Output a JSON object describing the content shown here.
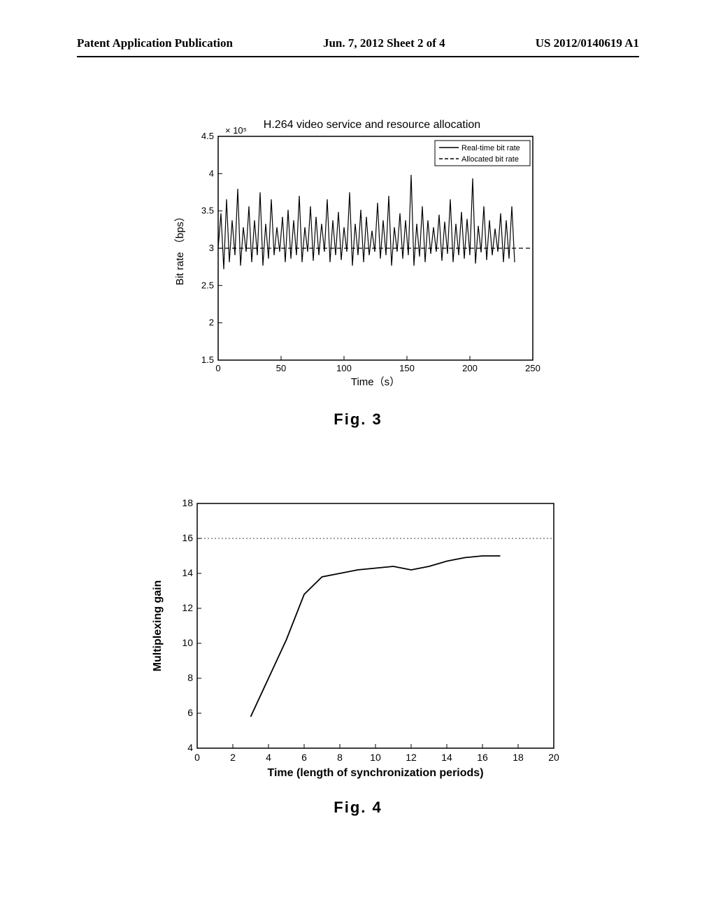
{
  "header": {
    "left": "Patent Application Publication",
    "center": "Jun. 7, 2012  Sheet 2 of 4",
    "right": "US 2012/0140619 A1"
  },
  "fig3": {
    "title": "H.264 video service and resource allocation",
    "exponent": "× 10⁵",
    "ylabel": "Bit rate （bps）",
    "xlabel": "Time（s）",
    "legend1": "Real-time bit rate",
    "legend2": "Allocated bit rate",
    "caption": "Fig. 3"
  },
  "fig4": {
    "ylabel": "Multiplexing gain",
    "xlabel": "Time (length of synchronization periods)",
    "caption": "Fig. 4"
  },
  "chart_data": [
    {
      "type": "line",
      "title": "H.264 video service and resource allocation",
      "xlabel": "Time (s)",
      "ylabel": "Bit rate (bps)",
      "xlim": [
        0,
        250
      ],
      "ylim": [
        150000.0,
        450000.0
      ],
      "xticks": [
        0,
        50,
        100,
        150,
        200,
        250
      ],
      "yticks": [
        1.5,
        2,
        2.5,
        3,
        3.5,
        4,
        4.5
      ],
      "y_exponent": 5,
      "series": [
        {
          "name": "Real-time bit rate",
          "style": "solid",
          "note": "Highly oscillating signal ~2.5e5–4.0e5 bps over 0–250s; dense spikes every ~3–5s"
        },
        {
          "name": "Allocated bit rate",
          "style": "dashed",
          "x": [
            0,
            250
          ],
          "y": [
            300000.0,
            300000.0
          ]
        }
      ]
    },
    {
      "type": "line",
      "title": "",
      "xlabel": "Time (length of synchronization periods)",
      "ylabel": "Multiplexing gain",
      "xlim": [
        0,
        20
      ],
      "ylim": [
        4,
        18
      ],
      "xticks": [
        0,
        2,
        4,
        6,
        8,
        10,
        12,
        14,
        16,
        18,
        20
      ],
      "yticks": [
        4,
        6,
        8,
        10,
        12,
        14,
        16,
        18
      ],
      "grid_y": [
        16
      ],
      "series": [
        {
          "name": "Multiplexing gain",
          "style": "solid",
          "x": [
            3,
            4,
            5,
            6,
            7,
            8,
            9,
            10,
            11,
            12,
            13,
            14,
            15,
            16,
            17
          ],
          "y": [
            5.8,
            8.0,
            10.2,
            12.8,
            13.8,
            14.0,
            14.2,
            14.3,
            14.4,
            14.2,
            14.4,
            14.7,
            14.9,
            15.0,
            15.0
          ]
        }
      ]
    }
  ]
}
